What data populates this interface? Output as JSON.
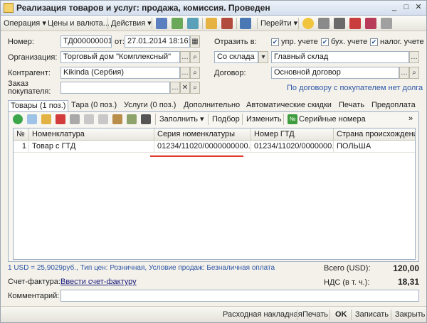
{
  "window": {
    "title": "Реализация товаров и услуг: продажа, комиссия. Проведен"
  },
  "toolbar": {
    "operation": "Операция ▾",
    "prices": "Цены и валюта...",
    "actions": "Действия ▾",
    "goto": "Перейти ▾"
  },
  "form": {
    "number_label": "Номер:",
    "number_value": "ТД000000001",
    "date_label": "от:",
    "date_value": "27.01.2014 18:16:04",
    "reflect_label": "Отразить в:",
    "reflect_mgmt": "упр. учете",
    "reflect_acc": "бух. учете",
    "reflect_tax": "налог. учете",
    "org_label": "Организация:",
    "org_value": "Торговый дом \"Комплексный\"",
    "warehouse_mode": "Со склада",
    "warehouse_value": "Главный склад",
    "counterparty_label": "Контрагент:",
    "counterparty_value": "Kikinda (Сербия)",
    "contract_label": "Договор:",
    "contract_value": "Основной договор",
    "order_label_1": "Заказ",
    "order_label_2": "покупателя:",
    "order_value": "",
    "order_link": "По договору с покупателем нет долга"
  },
  "tabs": [
    {
      "label": "Товары (1 поз.)"
    },
    {
      "label": "Тара (0 поз.)"
    },
    {
      "label": "Услуги (0 поз.)"
    },
    {
      "label": "Дополнительно"
    },
    {
      "label": "Автоматические скидки"
    },
    {
      "label": "Печать"
    },
    {
      "label": "Предоплата"
    }
  ],
  "panel_toolbar": {
    "fill": "Заполнить ▾",
    "select": "Подбор",
    "change": "Изменить",
    "serials": "Серийные номера"
  },
  "table": {
    "headers": [
      "№",
      "Номенклатура",
      "Серия номенклатуры",
      "Номер ГТД",
      "Страна происхождения"
    ],
    "rows": [
      [
        "1",
        "Товар с ГТД",
        "01234/11020/0000000000...",
        "01234/11020/0000000...",
        "ПОЛЬША"
      ]
    ]
  },
  "summary": {
    "rate_text": "1 USD = 25,9029руб., Тип цен: Розничная, Условие продаж: Безналичная оплата",
    "total_label": "Всего (USD):",
    "total_value": "120,00",
    "invoice_label": "Счет-фактура:",
    "invoice_link": "Ввести счет-фактуру",
    "vat_label": "НДС (в т. ч.):",
    "vat_value": "18,31",
    "comment_label": "Комментарий:",
    "comment_value": ""
  },
  "footer": {
    "waybill": "Расходная накладная",
    "print": "Печать",
    "ok": "OK",
    "save": "Записать",
    "close": "Закрыть"
  },
  "colors": {
    "accent_link": "#2d56a7",
    "highlight": "#e03a2c"
  }
}
